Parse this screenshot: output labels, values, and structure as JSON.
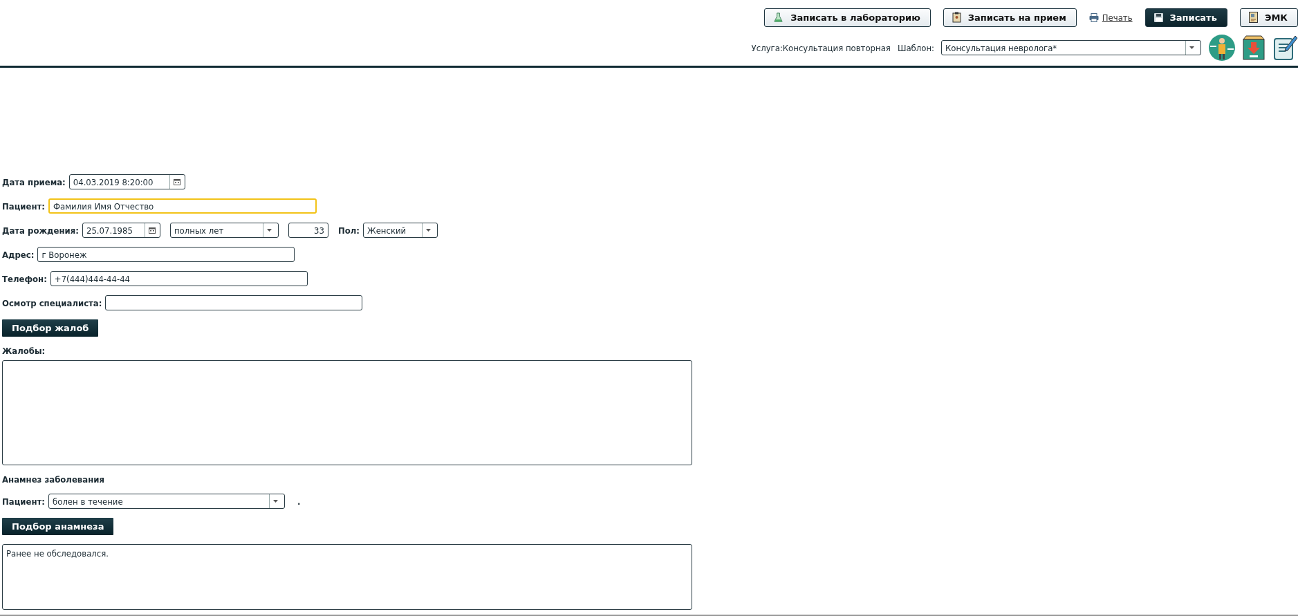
{
  "toolbar": {
    "buttons": [
      {
        "label": "Записать в лабораторию",
        "kind": "flask"
      },
      {
        "label": "Записать на прием",
        "kind": "clipboard"
      },
      {
        "label": "Печать",
        "kind": "print"
      },
      {
        "label": "Записать",
        "kind": "save"
      },
      {
        "label": "ЭМК",
        "kind": "card"
      }
    ]
  },
  "service": {
    "text": "Услуга:Консультация повторная"
  },
  "template": {
    "label": "Шаблон:",
    "value": "Консультация невролога*"
  },
  "form": {
    "visit_date": {
      "label": "Дата приема:",
      "value": "04.03.2019  8:20:00"
    },
    "patient": {
      "label": "Пациент:",
      "value": "Фамилия Имя Отчество",
      "focused": true
    },
    "birth_date": {
      "label": "Дата рождения:",
      "value": "25.07.1985",
      "age_unit": "полных лет",
      "age": "33"
    },
    "sex": {
      "label": "Пол:",
      "value": "Женский"
    },
    "address": {
      "label": "Адрес:",
      "value": "г Воронеж"
    },
    "phone": {
      "label": "Телефон:",
      "value": "+7(444)444-44-44"
    },
    "specialist_exam": {
      "label": "Осмотр специалиста:"
    },
    "complaints_button": "Подбор жалоб",
    "complaints": {
      "label": "Жалобы:"
    },
    "anamnesis_title": "Анамнез заболевания",
    "anamnesis_patient": {
      "label": "Пациент:",
      "value": "болен в течение",
      "suffix": "."
    },
    "anamnesis_button": "Подбор анамнеза",
    "anamnesis": {
      "value": "Ранее не обследовался."
    }
  }
}
